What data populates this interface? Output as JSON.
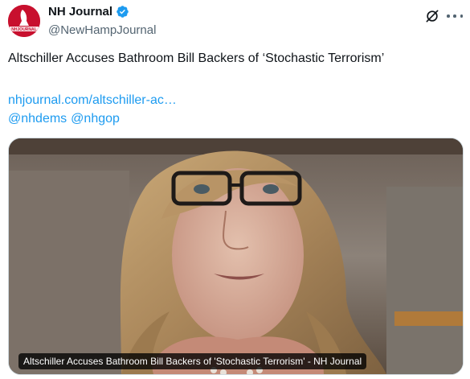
{
  "account": {
    "display_name": "NH Journal",
    "handle": "@NewHampJournal",
    "avatar_text": "NHJOURNAL"
  },
  "tweet": {
    "text": "Altschiller Accuses Bathroom Bill Backers of ‘Stochastic Terrorism’",
    "link": "nhjournal.com/altschiller-ac…",
    "mentions": [
      "@nhdems",
      "@nhgop"
    ]
  },
  "media": {
    "caption": "Altschiller Accuses Bathroom Bill Backers of 'Stochastic Terrorism' - NH Journal"
  },
  "colors": {
    "link": "#1d9bf0",
    "verified": "#1d9bf0",
    "secondary_text": "#536471",
    "avatar_brand": "#c8102e"
  },
  "icons": [
    "verified-badge-icon",
    "grok-icon",
    "more-options-icon"
  ]
}
